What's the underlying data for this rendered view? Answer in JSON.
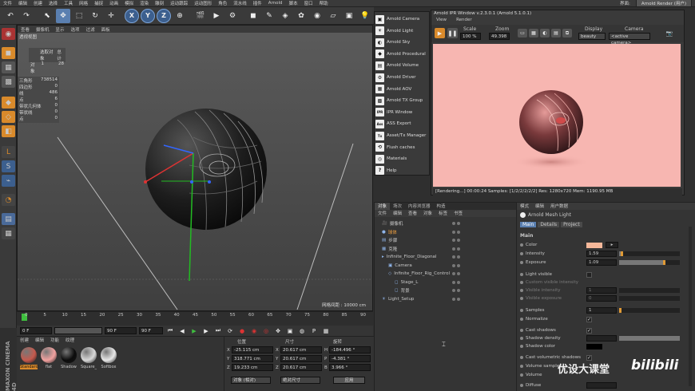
{
  "menubar": {
    "items": [
      "文件",
      "编辑",
      "创建",
      "选择",
      "工具",
      "网格",
      "捕捉",
      "动画",
      "模拟",
      "渲染",
      "雕刻",
      "运动跟踪",
      "运动图形",
      "角色",
      "流水线",
      "插件",
      "Arnold",
      "脚本",
      "窗口",
      "帮助"
    ],
    "layout_label": "界面:",
    "layout_value": "Arnold Render (用户)"
  },
  "viewport": {
    "menu": [
      "查看",
      "摄像机",
      "显示",
      "选项",
      "过滤",
      "面板"
    ],
    "title": "透视视图",
    "stats_header": [
      "选取对象",
      "总计"
    ],
    "stats_object": [
      "对象",
      "1",
      "28"
    ],
    "scene_stats": [
      {
        "k": "三角形",
        "v": "738514"
      },
      {
        "k": "四边形",
        "v": "0"
      },
      {
        "k": "线",
        "v": "486"
      },
      {
        "k": "点",
        "v": "6"
      },
      {
        "k": "带状几何体",
        "v": "0"
      },
      {
        "k": "带状线",
        "v": "0"
      },
      {
        "k": "点",
        "v": "0"
      }
    ],
    "footer": "网格间距 : 10000 cm"
  },
  "timeline": {
    "ticks": [
      "0",
      "5",
      "10",
      "15",
      "20",
      "25",
      "30",
      "35",
      "40",
      "45",
      "50",
      "55",
      "60",
      "65",
      "70",
      "75",
      "80",
      "85",
      "90"
    ],
    "current_frame": "0 F",
    "start_field": "0 F",
    "end_field": "90 F",
    "end_right": "90 F",
    "frame_right": "0 F"
  },
  "materials": {
    "menu": [
      "创建",
      "编辑",
      "功能",
      "纹理"
    ],
    "items": [
      {
        "label": "Standard",
        "color": "#c55a4e",
        "selected": true
      },
      {
        "label": "flat",
        "color": "#f2a2a0",
        "selected": false
      },
      {
        "label": "Shadow",
        "color": "#0c0c0c",
        "selected": false
      },
      {
        "label": "Square_",
        "color": "#d8d8d8",
        "selected": false
      },
      {
        "label": "Softbox",
        "color": "#e8e8e8",
        "selected": false
      }
    ],
    "logo": "MAXON CINEMA 4D"
  },
  "coords": {
    "headers": [
      "位置",
      "尺寸",
      "旋转"
    ],
    "rows": [
      {
        "a": "X",
        "pos": "-25.115 cm",
        "b": "X",
        "size": "20.617 cm",
        "c": "H",
        "rot": "-184.496 °"
      },
      {
        "a": "Y",
        "pos": "318.771 cm",
        "b": "Y",
        "size": "20.617 cm",
        "c": "P",
        "rot": "-4.381 °"
      },
      {
        "a": "Z",
        "pos": "19.233 cm",
        "b": "Z",
        "size": "20.617 cm",
        "c": "B",
        "rot": "3.966 °"
      }
    ],
    "mode1": "对象 (相对)",
    "mode2": "绝对尺寸",
    "apply": "应用"
  },
  "arnold_menu": [
    {
      "icon": "▣",
      "label": "Arnold Camera"
    },
    {
      "icon": "☀",
      "label": "Arnold Light"
    },
    {
      "icon": "◐",
      "label": "Arnold Sky"
    },
    {
      "icon": "◆",
      "label": "Arnold Procedural"
    },
    {
      "icon": "▤",
      "label": "Arnold Volume"
    },
    {
      "icon": "⚙",
      "label": "Arnold Driver"
    },
    {
      "icon": "▦",
      "label": "Arnold AOV"
    },
    {
      "icon": "▩",
      "label": "Arnold TX Group"
    },
    {
      "icon": "IPR",
      "label": "IPR Window"
    },
    {
      "icon": "Ass",
      "label": "ASS Export"
    },
    {
      "icon": "Tx",
      "label": "Asset/Tx Manager"
    },
    {
      "icon": "⟲",
      "label": "Flush caches"
    },
    {
      "icon": "◎",
      "label": "Materials"
    },
    {
      "icon": "?",
      "label": "Help"
    }
  ],
  "ipr": {
    "title": "Arnold IPR Window v.2.3.0.1 (Arnold 5.1.0.1)",
    "menu": [
      "View",
      "Render"
    ],
    "scale_label": "Scale",
    "scale_value": "100 %",
    "zoom_label": "Zoom",
    "zoom_value": "49.398",
    "display_label": "Display",
    "display_value": "beauty",
    "camera_label": "Camera",
    "camera_value": "<active camera>",
    "status": "[Rendering...] 00:00:24  Samples: [1/2/2/2/2/2]  Res: 1280x720  Mem: 1190.95 MB",
    "bg_color": "#f7b6b1"
  },
  "objects": {
    "tabs": [
      "对象",
      "场次",
      "内容浏览器",
      "构造"
    ],
    "menu": [
      "文件",
      "编辑",
      "查看",
      "对象",
      "标签",
      "书签"
    ],
    "rows": [
      {
        "name": "摄像机",
        "indent": 0,
        "icon": "🎥"
      },
      {
        "name": "球体",
        "indent": 0,
        "icon": "●",
        "highlight": true
      },
      {
        "name": "步骤",
        "indent": 0,
        "icon": "▤"
      },
      {
        "name": "克隆",
        "indent": 0,
        "icon": "▦"
      },
      {
        "name": "Infinite_Floor_Diagonal",
        "indent": 0,
        "icon": "▸"
      },
      {
        "name": "Camera",
        "indent": 1,
        "icon": "▣"
      },
      {
        "name": "Infinite_Floor_Rig_Control",
        "indent": 1,
        "icon": "◇"
      },
      {
        "name": "Stage_L",
        "indent": 2,
        "icon": "◻"
      },
      {
        "name": "背景",
        "indent": 2,
        "icon": "◻"
      },
      {
        "name": "Light_Setup",
        "indent": 0,
        "icon": "☀"
      }
    ]
  },
  "attributes": {
    "menu": [
      "模式",
      "编辑",
      "用户数据"
    ],
    "object_name": "Arnold Mesh Light",
    "tabs": [
      "Main",
      "Details",
      "Project"
    ],
    "section": "Main",
    "color_label": "Color",
    "color_swatch": "#f5b89a",
    "intensity_label": "Intensity",
    "intensity_value": "1.59",
    "intensity_level": 0.03,
    "exposure_label": "Exposure",
    "exposure_value": "1.09",
    "exposure_level": 0.72,
    "light_visible": "Light visible",
    "custom_visible": "Custom visible intensity",
    "visible_intensity": "Visible intensity",
    "visible_intensity_value": "1",
    "visible_exposure": "Visible exposure",
    "visible_exposure_value": "0",
    "samples_label": "Samples",
    "samples_value": "1",
    "normalize_label": "Normalize",
    "cast_shadows": "Cast shadows",
    "shadow_density": "Shadow density",
    "shadow_color": "Shadow color",
    "cast_volumetric": "Cast volumetric shadows",
    "volume_samples": "Volume samples",
    "volume": "Volume",
    "diffuse": "Diffuse"
  },
  "watermark": {
    "text": "优设大课堂",
    "brand": "bilibili"
  }
}
